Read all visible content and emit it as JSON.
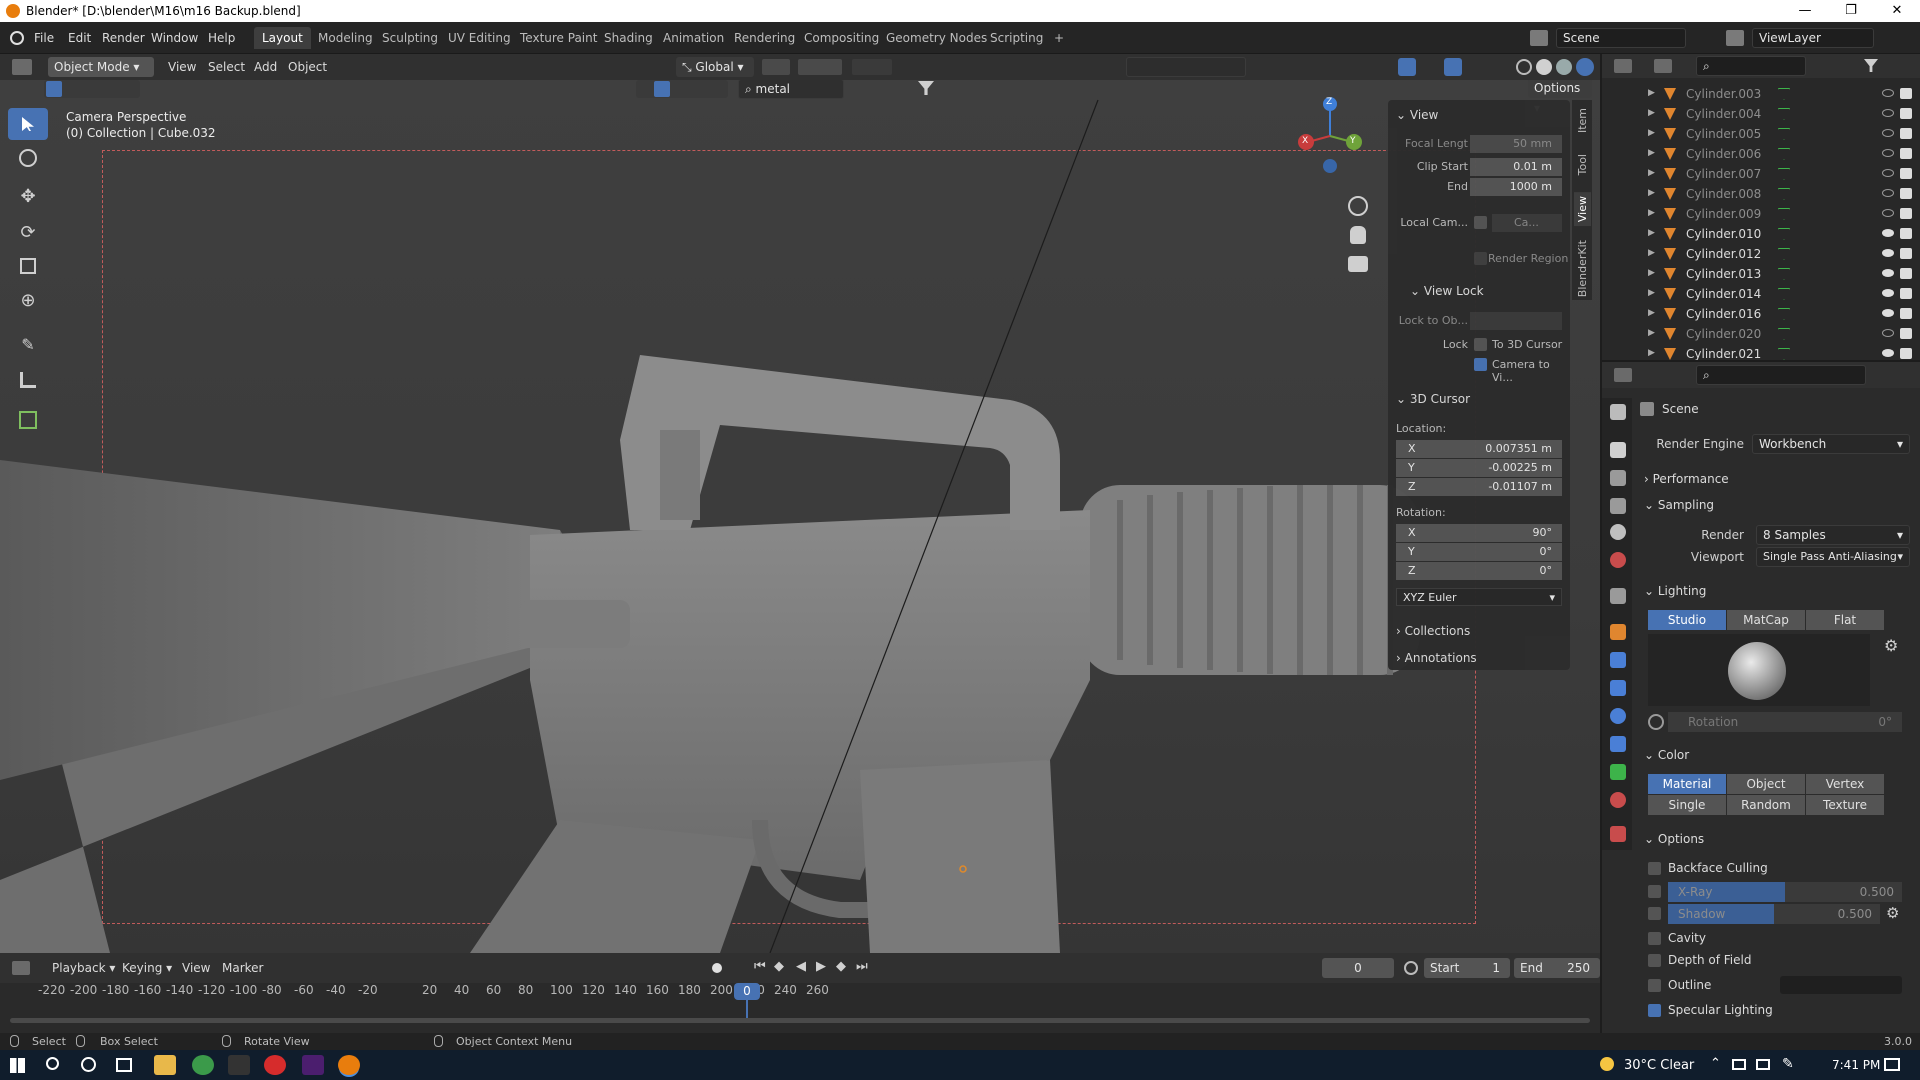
{
  "window": {
    "title": "Blender* [D:\\blender\\M16\\m16 Backup.blend]",
    "min": "—",
    "max": "❐",
    "close": "✕"
  },
  "menu": [
    "File",
    "Edit",
    "Render",
    "Window",
    "Help"
  ],
  "workspaces": [
    "Layout",
    "Modeling",
    "Sculpting",
    "UV Editing",
    "Texture Paint",
    "Shading",
    "Animation",
    "Rendering",
    "Compositing",
    "Geometry Nodes",
    "Scripting",
    "+"
  ],
  "scene": {
    "name": "Scene",
    "view_layer": "ViewLayer"
  },
  "viewport_header": {
    "mode": "Object Mode",
    "menus": [
      "View",
      "Select",
      "Add",
      "Object"
    ],
    "orientation": "Global",
    "search": "metal",
    "options": "Options"
  },
  "viewport": {
    "perspective": "Camera Perspective",
    "collection": "(0) Collection | Cube.032",
    "gizmo": {
      "x": "X",
      "y": "Y",
      "z": "Z"
    }
  },
  "npanel": {
    "tabs": [
      "Item",
      "Tool",
      "View",
      "BlenderKit"
    ],
    "view": {
      "title": "View",
      "focal_label": "Focal Lengt",
      "focal_value": "50 mm",
      "clip_start_label": "Clip Start",
      "clip_start_value": "0.01 m",
      "end_label": "End",
      "end_value": "1000 m",
      "local_camera_label": "Local Cam...",
      "local_camera_value": "Ca...",
      "render_region": "Render Region"
    },
    "view_lock": {
      "title": "View Lock",
      "lock_to_obj": "Lock to Ob...",
      "lock_label": "Lock",
      "to_3d_cursor": "To 3D Cursor",
      "camera_to_view": "Camera to Vi..."
    },
    "cursor": {
      "title": "3D Cursor",
      "location": "Location:",
      "x_label": "X",
      "x": "0.007351 m",
      "y_label": "Y",
      "y": "-0.00225 m",
      "z_label": "Z",
      "z": "-0.01107 m",
      "rotation": "Rotation:",
      "rx_label": "X",
      "rx": "90°",
      "ry_label": "Y",
      "ry": "0°",
      "rz_label": "Z",
      "rz": "0°",
      "mode": "XYZ Euler"
    },
    "collections": "Collections",
    "annotations": "Annotations"
  },
  "outliner": {
    "search_placeholder": "",
    "rows": [
      {
        "name": "Cylinder.003",
        "visible": false
      },
      {
        "name": "Cylinder.004",
        "visible": false
      },
      {
        "name": "Cylinder.005",
        "visible": false
      },
      {
        "name": "Cylinder.006",
        "visible": false
      },
      {
        "name": "Cylinder.007",
        "visible": false
      },
      {
        "name": "Cylinder.008",
        "visible": false
      },
      {
        "name": "Cylinder.009",
        "visible": false
      },
      {
        "name": "Cylinder.010",
        "visible": true
      },
      {
        "name": "Cylinder.012",
        "visible": true
      },
      {
        "name": "Cylinder.013",
        "visible": true
      },
      {
        "name": "Cylinder.014",
        "visible": true
      },
      {
        "name": "Cylinder.016",
        "visible": true
      },
      {
        "name": "Cylinder.020",
        "visible": false
      },
      {
        "name": "Cylinder.021",
        "visible": true
      }
    ]
  },
  "properties": {
    "context": "Scene",
    "render_engine_label": "Render Engine",
    "render_engine": "Workbench",
    "performance": "Performance",
    "sampling": "Sampling",
    "render_label": "Render",
    "render_value": "8 Samples",
    "viewport_label": "Viewport",
    "viewport_value": "Single Pass Anti-Aliasing",
    "lighting": "Lighting",
    "lighting_modes": [
      "Studio",
      "MatCap",
      "Flat"
    ],
    "rotation_label": "Rotation",
    "rotation_value": "0°",
    "color": "Color",
    "color_modes": [
      "Material",
      "Object",
      "Vertex",
      "Single",
      "Random",
      "Texture"
    ],
    "options": "Options",
    "backface": "Backface Culling",
    "xray": "X-Ray",
    "xray_value": "0.500",
    "xray_fill": 0.5,
    "shadow": "Shadow",
    "shadow_value": "0.500",
    "shadow_fill": 0.5,
    "cavity": "Cavity",
    "dof": "Depth of Field",
    "outline": "Outline",
    "specular": "Specular Lighting"
  },
  "timeline": {
    "menus": [
      "Playback",
      "Keying",
      "View",
      "Marker"
    ],
    "current": "0",
    "start_label": "Start",
    "start": "1",
    "end_label": "End",
    "end": "250",
    "ticks": [
      "-220",
      "-200",
      "-180",
      "-160",
      "-140",
      "-120",
      "-100",
      "-80",
      "-60",
      "-40",
      "-20",
      "0",
      "20",
      "40",
      "60",
      "80",
      "100",
      "120",
      "140",
      "160",
      "180",
      "200",
      "220",
      "240",
      "260"
    ],
    "playhead": "0"
  },
  "status": {
    "select": "Select",
    "box_select": "Box Select",
    "rotate": "Rotate View",
    "context": "Object Context Menu",
    "version": "3.0.0"
  },
  "taskbar": {
    "weather": "30°C Clear",
    "time": "7:41 PM"
  }
}
